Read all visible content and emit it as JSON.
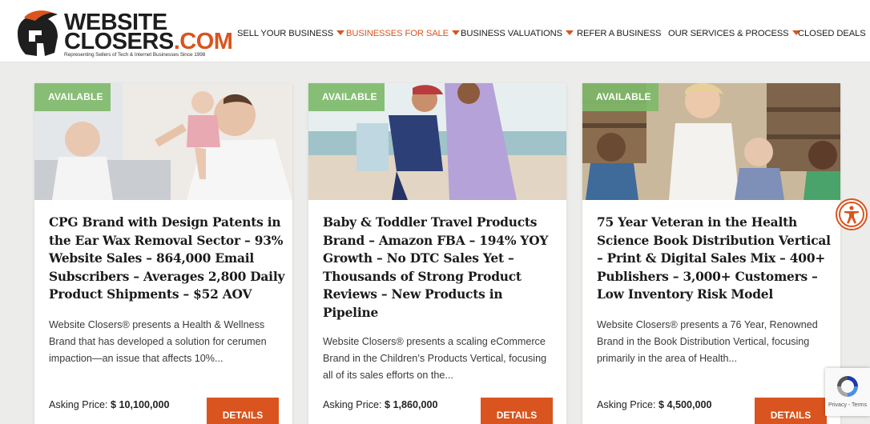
{
  "header": {
    "logo": {
      "line1": "WEBSITE",
      "line2": "CLOSERS",
      "dotcom": ".COM",
      "tagline": "Representing Sellers of Tech & Internet Businesses Since 1998"
    },
    "nav": [
      {
        "label": "SELL YOUR BUSINESS",
        "dropdown": true,
        "active": false
      },
      {
        "label": "BUSINESSES FOR SALE",
        "dropdown": true,
        "active": true
      },
      {
        "label": "BUSINESS VALUATIONS",
        "dropdown": true,
        "active": false
      },
      {
        "label": "REFER A BUSINESS",
        "dropdown": false,
        "active": false
      },
      {
        "label": "OUR SERVICES & PROCESS",
        "dropdown": true,
        "active": false
      },
      {
        "label": "CLOSED DEALS",
        "dropdown": false,
        "active": false
      }
    ]
  },
  "listings": [
    {
      "badge": "AVAILABLE",
      "image_icon": "family-photo",
      "title": "CPG Brand with Design Patents in the Ear Wax Removal Sector – 93% Website Sales – 864,000 Email Subscribers – Averages 2,800 Daily Product Shipments – $52 AOV",
      "description": "Website Closers® presents a Health & Wellness Brand that has developed a solution for cerumen impaction—an issue that affects 10%...",
      "price_label": "Asking Price: ",
      "price": "$ 10,100,000",
      "button": "DETAILS"
    },
    {
      "badge": "AVAILABLE",
      "image_icon": "beach-family-photo",
      "title": "Baby & Toddler Travel Products Brand – Amazon FBA – 194% YOY Growth – No DTC Sales Yet – Thousands of Strong Product Reviews – New Products in Pipeline",
      "description": "Website Closers® presents a scaling eCommerce Brand in the Children’s Products Vertical, focusing all of its sales efforts on the...",
      "price_label": "Asking Price: ",
      "price": "$ 1,860,000",
      "button": "DETAILS"
    },
    {
      "badge": "AVAILABLE",
      "image_icon": "library-students-photo",
      "title": "75 Year Veteran in the Health Science Book Distribution Vertical – Print & Digital Sales Mix – 400+ Publishers – 3,000+ Customers – Low Inventory Risk Model",
      "description": "Website Closers® presents a 76 Year, Renowned Brand in the Book Distribution Vertical, focusing primarily in the area of Health...",
      "price_label": "Asking Price: ",
      "price": "$ 4,500,000",
      "button": "DETAILS"
    }
  ],
  "widgets": {
    "accessibility_icon": "accessibility-icon",
    "recaptcha_text": "Privacy - Terms"
  },
  "colors": {
    "accent": "#d9541e",
    "badge": "#7fba6a",
    "background": "#ececea"
  }
}
